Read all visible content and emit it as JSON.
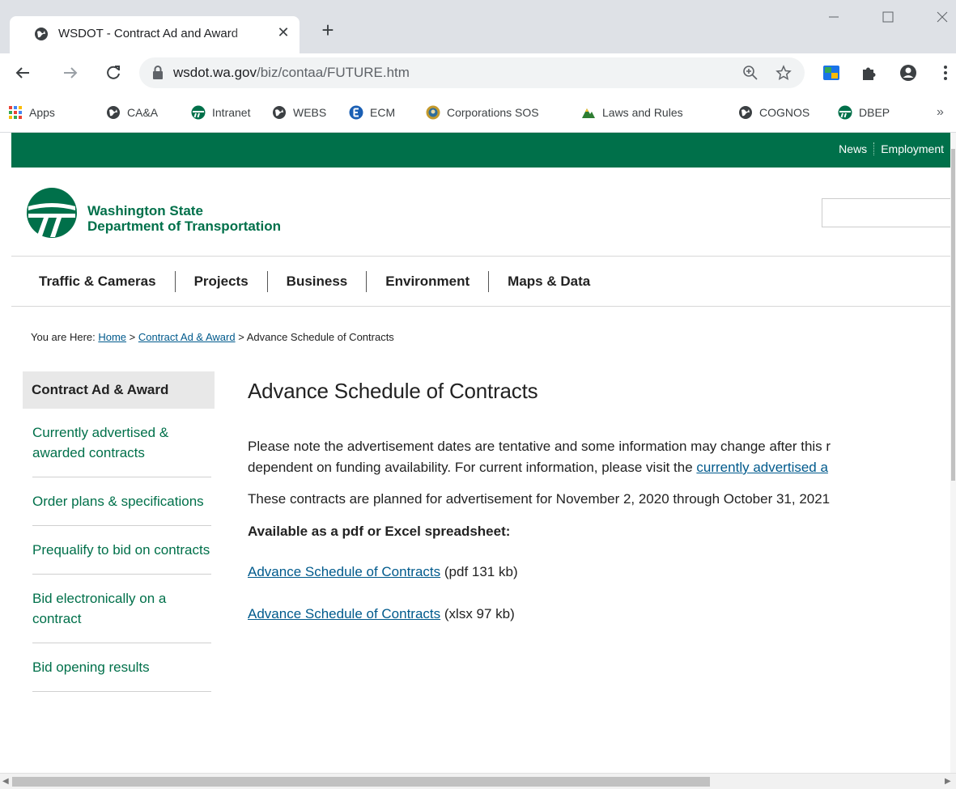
{
  "browser": {
    "tab_title": "WSDOT - Contract Ad and Award",
    "url_host": "wsdot.wa.gov",
    "url_path": "/biz/contaa/FUTURE.htm",
    "bookmarks": [
      "Apps",
      "CA&A",
      "Intranet",
      "WEBS",
      "ECM",
      "Corporations SOS",
      "Laws and Rules",
      "COGNOS",
      "DBEP"
    ],
    "bookmarks_more": "»"
  },
  "site": {
    "utility_links": [
      "News",
      "Employment"
    ],
    "agency_line1": "Washington State",
    "agency_line2": "Department of Transportation",
    "main_nav": [
      "Traffic & Cameras",
      "Projects",
      "Business",
      "Environment",
      "Maps & Data"
    ],
    "breadcrumb": {
      "prefix": "You are Here: ",
      "home": "Home",
      "sep": " > ",
      "section": "Contract Ad & Award",
      "current": "Advance Schedule of Contracts"
    },
    "side_nav": {
      "heading": "Contract Ad & Award",
      "items": [
        "Currently advertised & awarded contracts",
        "Order plans & specifications",
        "Prequalify to bid on contracts",
        "Bid electronically on a contract",
        "Bid opening results"
      ]
    }
  },
  "content": {
    "title": "Advance Schedule of Contracts",
    "note_line1": "Please note the advertisement dates are tentative and some information may change after this r",
    "note_line2_text": "dependent on funding availability. For current information, please visit the ",
    "note_line2_link": "currently advertised a",
    "planned": "These contracts are planned for advertisement for November 2, 2020 through October 31, 2021",
    "available": "Available as a pdf or Excel spreadsheet:",
    "downloads": [
      {
        "link": "Advance Schedule of Contracts",
        "info": " (pdf 131 kb)"
      },
      {
        "link": "Advance Schedule of Contracts",
        "info": " (xlsx 97 kb)"
      }
    ]
  },
  "colors": {
    "wsdot_green": "#00704a",
    "link_blue": "#005a8c"
  }
}
